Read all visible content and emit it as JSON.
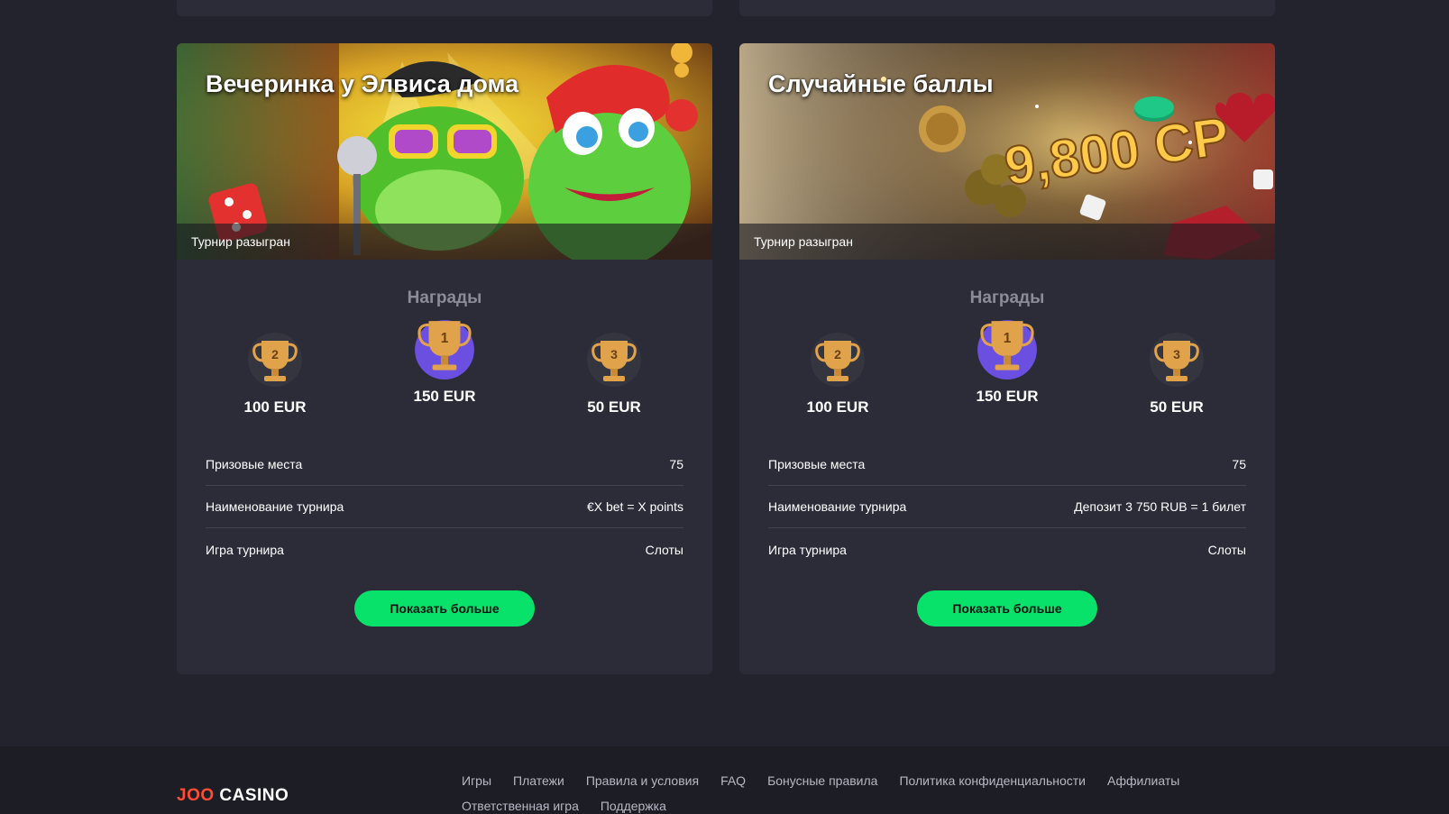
{
  "tournaments": [
    {
      "title": "Вечеринка у Элвиса дома",
      "status": "Турнир разыгран",
      "rewards_heading": "Награды",
      "prizes": [
        {
          "place": "2",
          "amount": "100 EUR"
        },
        {
          "place": "1",
          "amount": "150 EUR"
        },
        {
          "place": "3",
          "amount": "50 EUR"
        }
      ],
      "info": [
        {
          "label": "Призовые места",
          "value": "75"
        },
        {
          "label": "Наименование турнира",
          "value": "€X bet = X points"
        },
        {
          "label": "Игра турнира",
          "value": "Слоты"
        }
      ],
      "button_label": "Показать больше"
    },
    {
      "title": "Случайные баллы",
      "status": "Турнир разыгран",
      "rewards_heading": "Награды",
      "banner_text": "9,800 CP",
      "prizes": [
        {
          "place": "2",
          "amount": "100 EUR"
        },
        {
          "place": "1",
          "amount": "150 EUR"
        },
        {
          "place": "3",
          "amount": "50 EUR"
        }
      ],
      "info": [
        {
          "label": "Призовые места",
          "value": "75"
        },
        {
          "label": "Наименование турнира",
          "value": "Депозит 3 750 RUB = 1 билет"
        },
        {
          "label": "Игра турнира",
          "value": "Слоты"
        }
      ],
      "button_label": "Показать больше"
    }
  ],
  "footer": {
    "logo_part1": "JOO",
    "logo_part2": "CASINO",
    "links": [
      "Игры",
      "Платежи",
      "Правила и условия",
      "FAQ",
      "Бонусные правила",
      "Политика конфиденциальности",
      "Аффилиаты",
      "Ответственная игра",
      "Поддержка"
    ]
  },
  "colors": {
    "background": "#23232d",
    "card": "#2c2c38",
    "accent_green": "#08e26a",
    "logo_red": "#ff4d34",
    "trophy_gold": "#e0a24a",
    "first_place_circle": "#6b4fe0"
  }
}
